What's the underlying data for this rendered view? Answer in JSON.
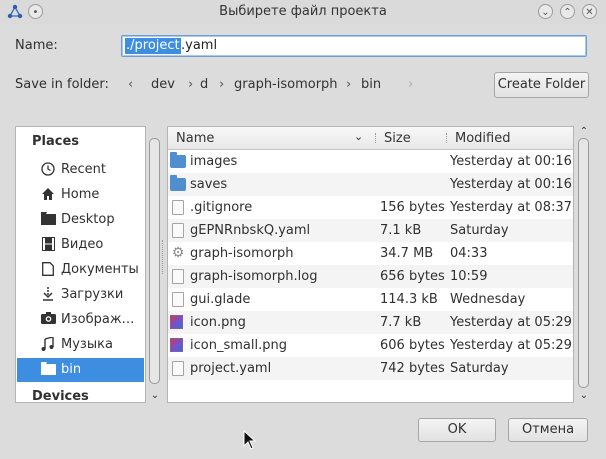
{
  "window": {
    "title": "Выбирете файл проекта"
  },
  "name_row": {
    "label": "Name:",
    "value_selected": "./project",
    "value_rest": ".yaml"
  },
  "save_in": {
    "label": "Save in folder:",
    "back_arrow": "‹",
    "forward_arrow": "›",
    "separator": "›",
    "crumbs": [
      "dev",
      "d",
      "graph-isomorph",
      "bin"
    ],
    "create_folder_label": "Create Folder"
  },
  "places": {
    "header": "Places",
    "items": [
      {
        "label": "Recent",
        "icon": "clock-icon"
      },
      {
        "label": "Home",
        "icon": "home-icon"
      },
      {
        "label": "Desktop",
        "icon": "folder-icon"
      },
      {
        "label": "Видео",
        "icon": "film-icon"
      },
      {
        "label": "Документы",
        "icon": "document-icon"
      },
      {
        "label": "Загрузки",
        "icon": "download-icon"
      },
      {
        "label": "Изображ…",
        "icon": "camera-icon"
      },
      {
        "label": "Музыка",
        "icon": "music-icon"
      },
      {
        "label": "bin",
        "icon": "folder-icon",
        "selected": true
      }
    ],
    "devices_header": "Devices"
  },
  "file_list": {
    "columns": {
      "name": "Name",
      "size": "Size",
      "modified": "Modified"
    },
    "rows": [
      {
        "name": "images",
        "size": "",
        "modified": "Yesterday at 00:16",
        "icon": "folder-icon"
      },
      {
        "name": "saves",
        "size": "",
        "modified": "Yesterday at 00:16",
        "icon": "folder-icon"
      },
      {
        "name": ".gitignore",
        "size": "156 bytes",
        "modified": "Yesterday at 08:37",
        "icon": "text-file-icon"
      },
      {
        "name": "gEPNRnbskQ.yaml",
        "size": "7.1 kB",
        "modified": "Saturday",
        "icon": "text-file-icon"
      },
      {
        "name": "graph-isomorph",
        "size": "34.7 MB",
        "modified": "04:33",
        "icon": "executable-gear-icon"
      },
      {
        "name": "graph-isomorph.log",
        "size": "656 bytes",
        "modified": "10:59",
        "icon": "text-file-icon"
      },
      {
        "name": "gui.glade",
        "size": "114.3 kB",
        "modified": "Wednesday",
        "icon": "text-file-icon"
      },
      {
        "name": "icon.png",
        "size": "7.7 kB",
        "modified": "Yesterday at 05:29",
        "icon": "image-file-icon"
      },
      {
        "name": "icon_small.png",
        "size": "606 bytes",
        "modified": "Yesterday at 05:29",
        "icon": "image-file-icon"
      },
      {
        "name": "project.yaml",
        "size": "742 bytes",
        "modified": "Saturday",
        "icon": "text-file-icon"
      }
    ]
  },
  "buttons": {
    "ok": "OK",
    "cancel": "Отмена"
  },
  "colors": {
    "selection": "#3d8ee0",
    "folder": "#4f8fd0",
    "window_bg": "#dcdcdc"
  }
}
